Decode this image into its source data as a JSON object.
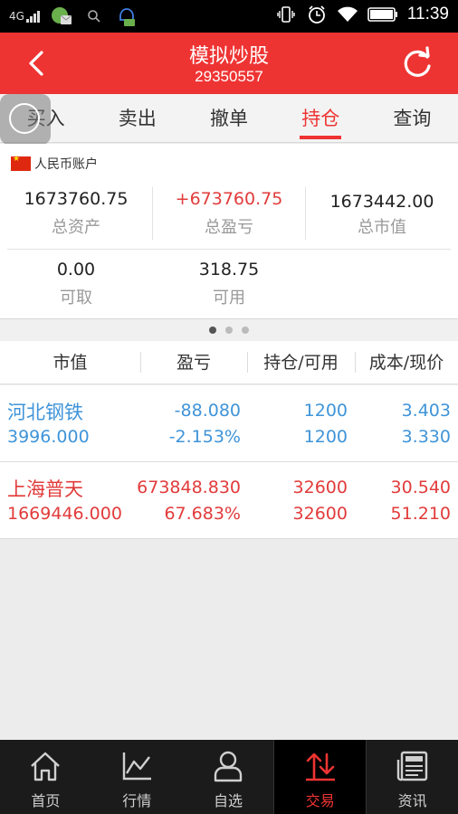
{
  "status_bar": {
    "network": "4G",
    "time": "11:39"
  },
  "header": {
    "title": "模拟炒股",
    "account_number": "29350557"
  },
  "tabs": [
    {
      "label": "买入"
    },
    {
      "label": "卖出"
    },
    {
      "label": "撤单"
    },
    {
      "label": "持仓"
    },
    {
      "label": "查询"
    }
  ],
  "active_tab": "持仓",
  "account": {
    "label": "人民币账户",
    "total_assets": {
      "value": "1673760.75",
      "label": "总资产"
    },
    "total_pl": {
      "value": "+673760.75",
      "label": "总盈亏"
    },
    "market_value": {
      "value": "1673442.00",
      "label": "总市值"
    },
    "withdrawable": {
      "value": "0.00",
      "label": "可取"
    },
    "available": {
      "value": "318.75",
      "label": "可用"
    }
  },
  "pager": {
    "count": 3,
    "active": 0
  },
  "table": {
    "headers": [
      "市值",
      "盈亏",
      "持仓/可用",
      "成本/现价"
    ],
    "rows": [
      {
        "name": "河北钢铁",
        "market_value": "3996.000",
        "pl": "-88.080",
        "pl_pct": "-2.153%",
        "position": "1200",
        "available": "1200",
        "cost": "3.403",
        "price": "3.330",
        "color": "#3f94d9"
      },
      {
        "name": "上海普天",
        "market_value": "1669446.000",
        "pl": "673848.830",
        "pl_pct": "67.683%",
        "position": "32600",
        "available": "32600",
        "cost": "30.540",
        "price": "51.210",
        "color": "#e23b3b"
      }
    ]
  },
  "bottom_nav": [
    {
      "label": "首页",
      "icon": "home-icon"
    },
    {
      "label": "行情",
      "icon": "chart-icon"
    },
    {
      "label": "自选",
      "icon": "person-icon"
    },
    {
      "label": "交易",
      "icon": "trade-arrows-icon"
    },
    {
      "label": "资讯",
      "icon": "news-icon"
    }
  ],
  "active_nav": "交易",
  "colors": {
    "brand": "#ee3433",
    "down": "#3f94d9",
    "up": "#e23b3b"
  }
}
